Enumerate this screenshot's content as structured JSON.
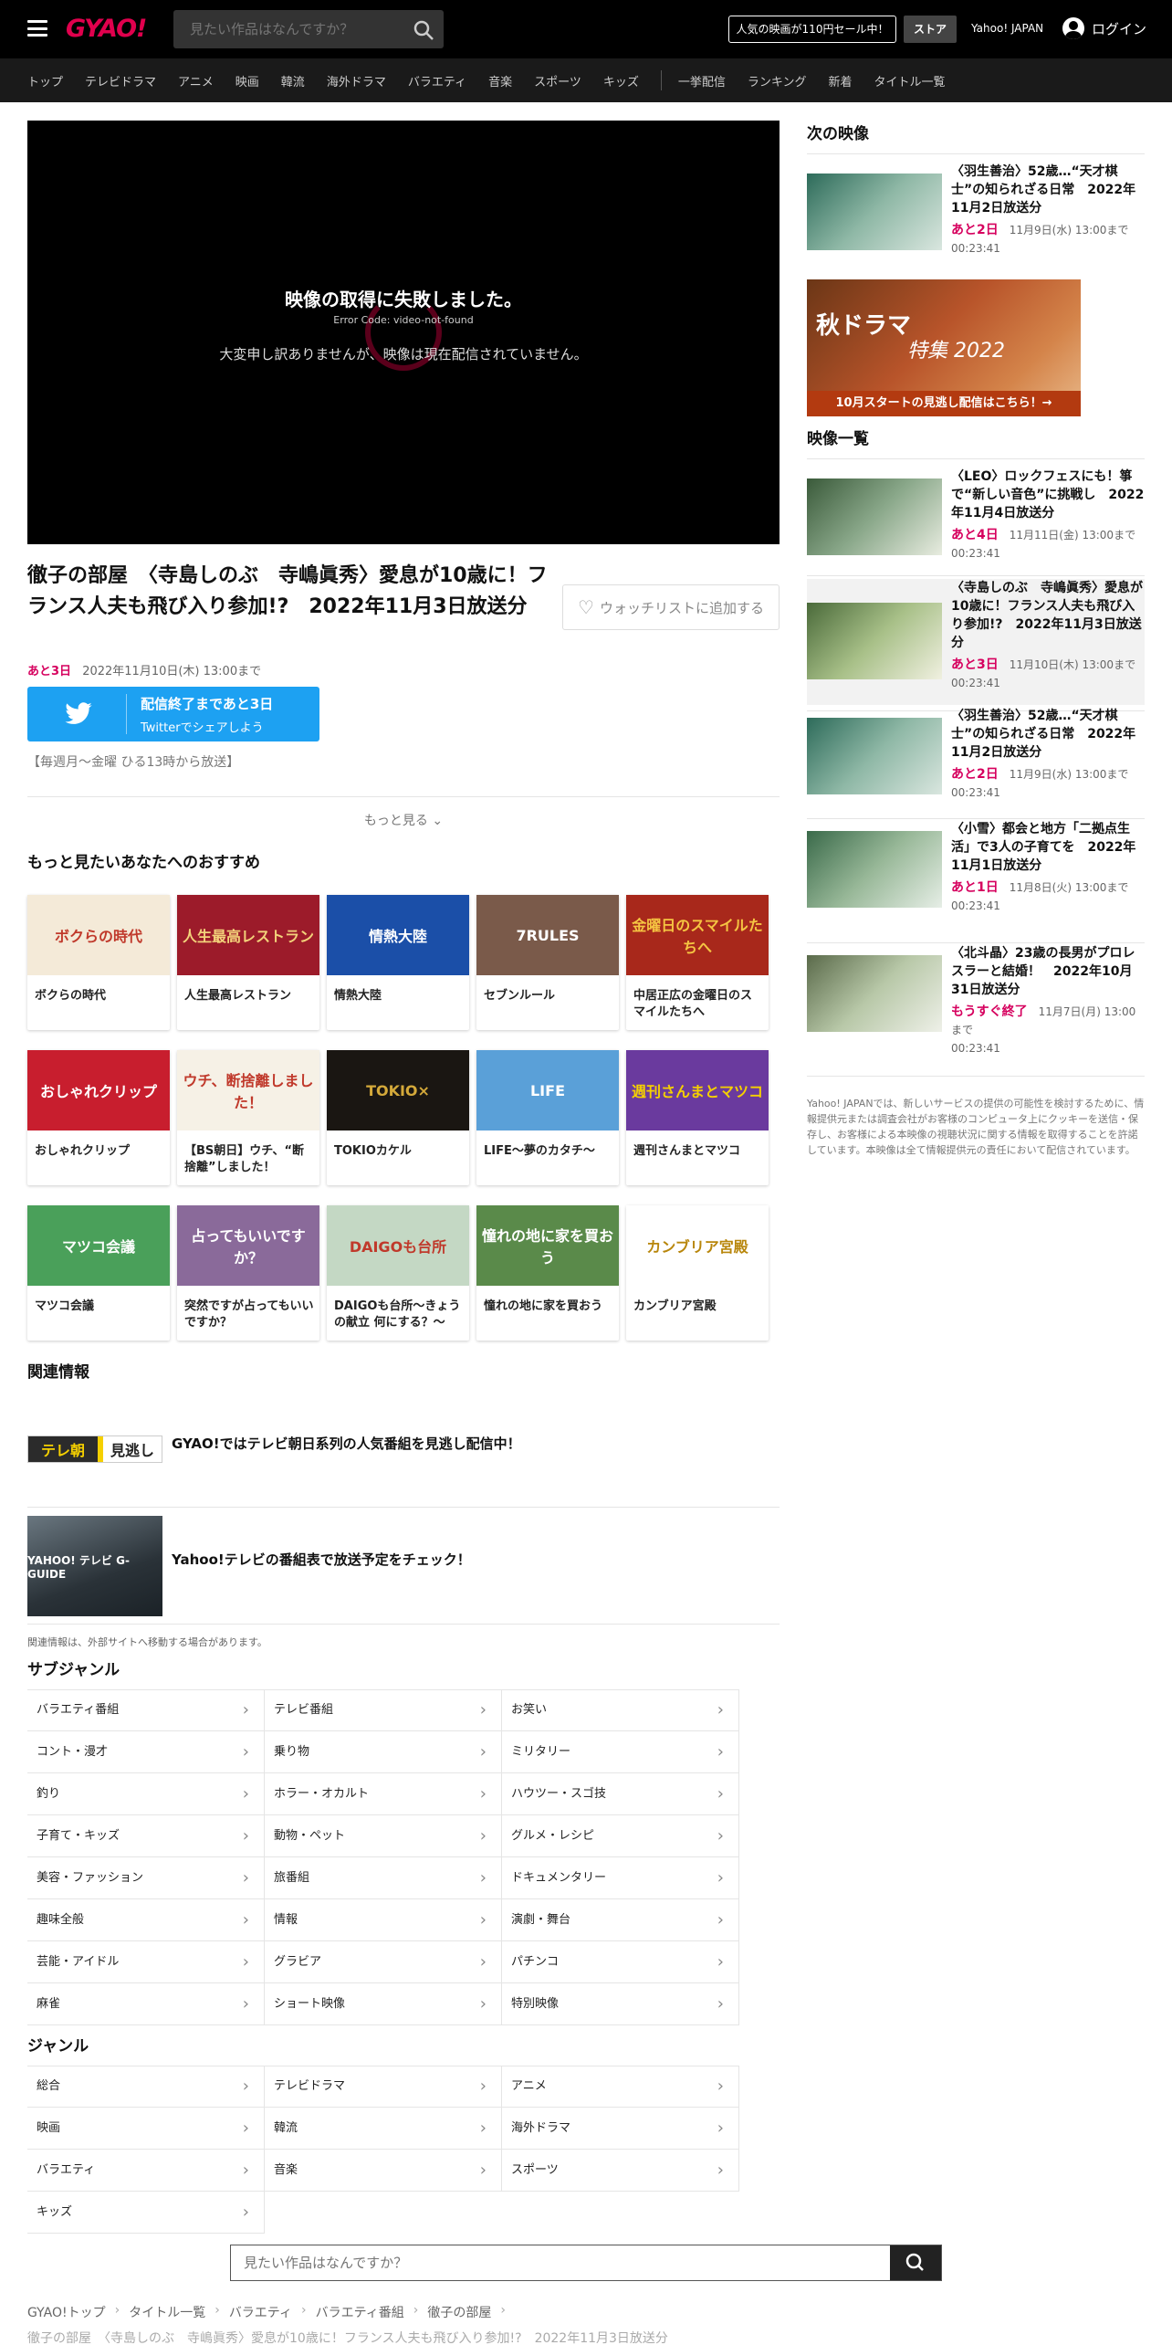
{
  "header": {
    "logo": "GYAO!",
    "search_placeholder": "見たい作品はなんですか？",
    "promo": "人気の映画が110円セール中！",
    "store": "ストア",
    "yahoo": "Yahoo! JAPAN",
    "login": "ログイン"
  },
  "nav": [
    "トップ",
    "テレビドラマ",
    "アニメ",
    "映画",
    "韓流",
    "海外ドラマ",
    "バラエティ",
    "音楽",
    "スポーツ",
    "キッズ",
    "一挙配信",
    "ランキング",
    "新着",
    "タイトル一覧"
  ],
  "player": {
    "error_title": "映像の取得に失敗しました。",
    "error_code": "Error Code: video-not-found",
    "error_message": "大変申し訳ありませんが、映像は現在配信されていません。"
  },
  "episode": {
    "title": "徹子の部屋　〈寺島しのぶ　寺嶋眞秀〉愛息が10歳に！フランス人夫も飛び入り参加!?　2022年11月3日放送分",
    "watchlist": "ウォッチリストに追加する",
    "days_left": "あと3日",
    "until": "2022年11月10日(木) 13:00まで",
    "twitter_line1": "配信終了まであと3日",
    "twitter_line2": "Twitterでシェアしよう",
    "schedule": "【毎週月～金曜 ひる13時から放送】",
    "more": "もっと見る"
  },
  "recommend": {
    "heading": "もっと見たいあなたへのおすすめ",
    "items": [
      {
        "title": "ボクらの時代",
        "thumb": "ボクらの時代",
        "color": "#f4ead8",
        "text_color": "#c0392b"
      },
      {
        "title": "人生最高レストラン",
        "thumb": "人生最高レストラン",
        "color": "#9c1b2a",
        "text_color": "#f3d27a"
      },
      {
        "title": "情熱大陸",
        "thumb": "情熱大陸",
        "color": "#1b4fa8",
        "text_color": "#ffffff"
      },
      {
        "title": "セブンルール",
        "thumb": "7RULES",
        "color": "#7a5a4a",
        "text_color": "#ffffff"
      },
      {
        "title": "中居正広の金曜日のスマイルたちへ",
        "thumb": "金曜日のスマイルたちへ",
        "color": "#a8281b",
        "text_color": "#f5c542"
      },
      {
        "title": "おしゃれクリップ",
        "thumb": "おしゃれクリップ",
        "color": "#c81e2e",
        "text_color": "#ffffff"
      },
      {
        "title": "【BS朝日】ウチ、“断捨離”しました！",
        "thumb": "ウチ、断捨離しました！",
        "color": "#f6f1e6",
        "text_color": "#c0392b"
      },
      {
        "title": "TOKIOカケル",
        "thumb": "TOKIO×",
        "color": "#1a1612",
        "text_color": "#d4a93a"
      },
      {
        "title": "LIFE～夢のカタチ～",
        "thumb": "LIFE",
        "color": "#5aa0d8",
        "text_color": "#ffffff"
      },
      {
        "title": "週刊さんまとマツコ",
        "thumb": "週刊さんまとマツコ",
        "color": "#6a3a9e",
        "text_color": "#f5d000"
      },
      {
        "title": "マツコ会議",
        "thumb": "マツコ会議",
        "color": "#4aa05a",
        "text_color": "#ffffff"
      },
      {
        "title": "突然ですが占ってもいいですか？",
        "thumb": "占ってもいいですか？",
        "color": "#8a6a9a",
        "text_color": "#ffffff"
      },
      {
        "title": "DAIGOも台所～きょうの献立 何にする？～",
        "thumb": "DAIGOも台所",
        "color": "#c4d8c4",
        "text_color": "#c0392b"
      },
      {
        "title": "憧れの地に家を買おう",
        "thumb": "憧れの地に家を買おう",
        "color": "#5a8a4a",
        "text_color": "#ffffff"
      },
      {
        "title": "カンブリア宮殿",
        "thumb": "カンブリア宮殿",
        "color": "#ffffff",
        "text_color": "#b8860b"
      }
    ]
  },
  "related": {
    "heading": "関連情報",
    "items": [
      {
        "text": "GYAO!ではテレビ朝日系列の人気番組を見逃し配信中！",
        "logo_a": "テレ朝",
        "logo_b": "見逃し"
      },
      {
        "text": "Yahoo!テレビの番組表で放送予定をチェック！",
        "logo": "YAHOO! テレビ G-GUIDE"
      }
    ],
    "note": "関連情報は、外部サイトへ移動する場合があります。"
  },
  "subgenre": {
    "heading": "サブジャンル",
    "items": [
      "バラエティ番組",
      "テレビ番組",
      "お笑い",
      "コント・漫才",
      "乗り物",
      "ミリタリー",
      "釣り",
      "ホラー・オカルト",
      "ハウツー・スゴ技",
      "子育て・キッズ",
      "動物・ペット",
      "グルメ・レシピ",
      "美容・ファッション",
      "旅番組",
      "ドキュメンタリー",
      "趣味全般",
      "情報",
      "演劇・舞台",
      "芸能・アイドル",
      "グラビア",
      "パチンコ",
      "麻雀",
      "ショート映像",
      "特別映像"
    ]
  },
  "genre": {
    "heading": "ジャンル",
    "items": [
      "総合",
      "テレビドラマ",
      "アニメ",
      "映画",
      "韓流",
      "海外ドラマ",
      "バラエティ",
      "音楽",
      "スポーツ",
      "キッズ"
    ]
  },
  "bottom_search": {
    "placeholder": "見たい作品はなんですか？"
  },
  "breadcrumb": [
    "GYAO!トップ",
    "タイトル一覧",
    "バラエティ",
    "バラエティ番組",
    "徹子の部屋"
  ],
  "breadcrumb_current": "徹子の部屋　〈寺島しのぶ　寺嶋眞秀〉愛息が10歳に！フランス人夫も飛び入り参加!?　2022年11月3日放送分",
  "sidebar": {
    "next_heading": "次の映像",
    "next": {
      "title": "〈羽生善治〉52歳…“天才棋士”の知られざる日常　2022年11月2日放送分",
      "days": "あと2日",
      "until": "11月9日(水) 13:00まで",
      "duration": "00:23:41"
    },
    "banner": {
      "title": "秋ドラマ",
      "sub": "特集 2022",
      "bar": "10月スタートの見逃し配信はこちら！→"
    },
    "list_heading": "映像一覧",
    "list": [
      {
        "title": "〈LEO〉ロックフェスにも！箏で“新しい音色”に挑戦し　2022年11月4日放送分",
        "days": "あと4日",
        "until": "11月11日(金) 13:00まで",
        "duration": "00:23:41"
      },
      {
        "title": "〈寺島しのぶ　寺嶋眞秀〉愛息が10歳に！フランス人夫も飛び入り参加!?　2022年11月3日放送分",
        "days": "あと3日",
        "until": "11月10日(木) 13:00まで",
        "duration": "00:23:41"
      },
      {
        "title": "〈羽生善治〉52歳…“天才棋士”の知られざる日常　2022年11月2日放送分",
        "days": "あと2日",
        "until": "11月9日(水) 13:00まで",
        "duration": "00:23:41"
      },
      {
        "title": "〈小雪〉都会と地方「二拠点生活」で3人の子育てを　2022年11月1日放送分",
        "days": "あと1日",
        "until": "11月8日(火) 13:00まで",
        "duration": "00:23:41"
      },
      {
        "title": "〈北斗晶〉23歳の長男がプロレスラーと結婚！　2022年10月31日放送分",
        "days": "もうすぐ終了",
        "until": "11月7日(月) 13:00まで",
        "duration": "00:23:41"
      }
    ],
    "notice": "Yahoo! JAPANでは、新しいサービスの提供の可能性を検討するために、情報提供元または調査会社がお客様のコンピュータ上にクッキーを送信・保存し、お客様による本映像の視聴状況に関する情報を取得することを許諾しています。本映像は全て情報提供元の責任において配信されています。"
  },
  "colors": {
    "brand": "#e0004d",
    "accent": "#d6005e",
    "twitter": "#1da1f2"
  }
}
